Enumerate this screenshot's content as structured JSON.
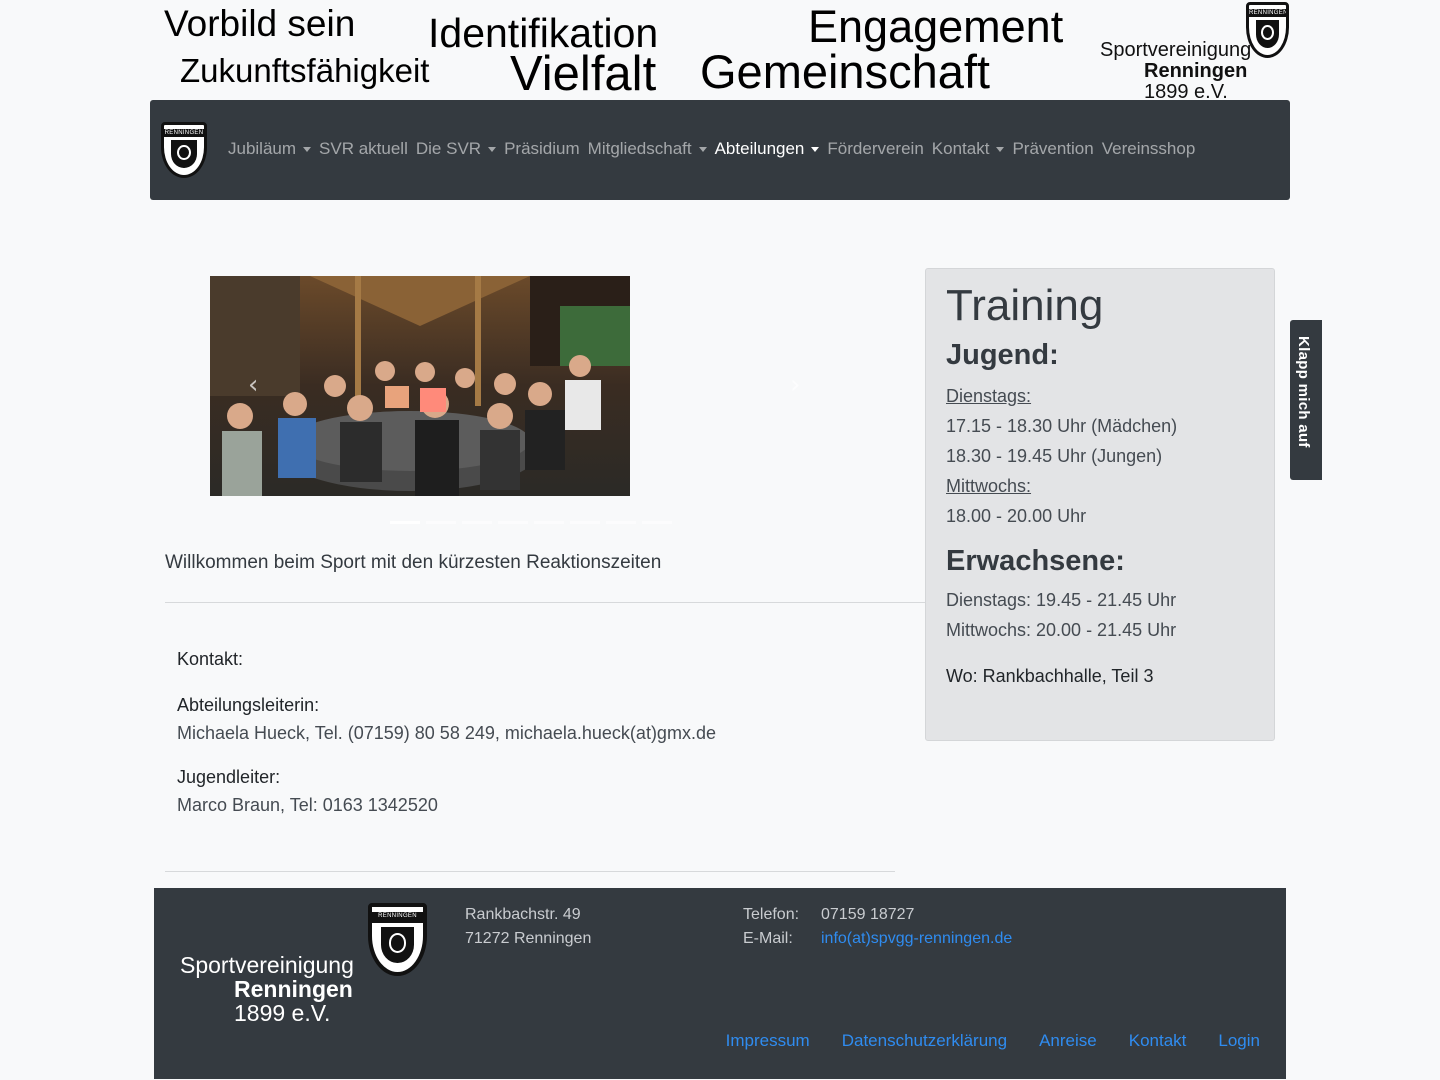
{
  "banner": {
    "slogans": [
      "Vorbild sein",
      "Zukunftsfähigkeit",
      "Identifikation",
      "Vielfalt",
      "Engagement",
      "Gemeinschaft"
    ],
    "logo": {
      "crest_text": "RENNINGEN",
      "line1": "Sportvereinigung",
      "line2": "Renningen",
      "line3": "1899 e.V."
    }
  },
  "nav": {
    "logo_icon": "club-crest-icon",
    "items": [
      {
        "label": "Jubiläum",
        "dropdown": true
      },
      {
        "label": "SVR aktuell",
        "dropdown": false
      },
      {
        "label": "Die SVR",
        "dropdown": true
      },
      {
        "label": "Präsidium",
        "dropdown": false
      },
      {
        "label": "Mitgliedschaft",
        "dropdown": true
      },
      {
        "label": "Abteilungen",
        "dropdown": true,
        "active": true
      },
      {
        "label": "Förderverein",
        "dropdown": false
      },
      {
        "label": "Kontakt",
        "dropdown": true
      },
      {
        "label": "Prävention",
        "dropdown": false
      },
      {
        "label": "Vereinsshop",
        "dropdown": false
      }
    ]
  },
  "carousel": {
    "prev_icon": "chevron-left-icon",
    "next_icon": "chevron-right-icon",
    "slide_count": 8,
    "active_index": 0
  },
  "main": {
    "welcome": "Willkommen beim Sport mit den kürzesten Reaktionszeiten",
    "contact_heading": "Kontakt:",
    "leader_label": "Abteilungsleiterin:",
    "leader_value": "Michaela Hueck, Tel. (07159) 80 58 249, michaela.hueck(at)gmx.de",
    "youth_label": "Jugendleiter:",
    "youth_value": "Marco Braun, Tel: 0163 1342520"
  },
  "training": {
    "title": "Training",
    "youth_heading": "Jugend:",
    "youth_day1": "Dienstags:",
    "youth_line1": "17.15 - 18.30 Uhr (Mädchen)",
    "youth_line2": "18.30 - 19.45 Uhr (Jungen)",
    "youth_day2": "Mittwochs:",
    "youth_line3": "18.00 - 20.00 Uhr",
    "adult_heading": "Erwachsene:",
    "adult_line1": "Dienstags: 19.45 - 21.45 Uhr",
    "adult_line2": "Mittwochs: 20.00 - 21.45 Uhr",
    "location": "Wo: Rankbachhalle, Teil 3"
  },
  "side_tab": {
    "label": "Klapp mich auf"
  },
  "footer": {
    "street": "Rankbachstr. 49",
    "city": "71272 Renningen",
    "phone_label": "Telefon:",
    "phone_value": "07159 18727",
    "email_label": "E-Mail:",
    "email_value": "info(at)spvgg-renningen.de",
    "links": [
      "Impressum",
      "Datenschutzerklärung",
      "Anreise",
      "Kontakt",
      "Login"
    ]
  },
  "colors": {
    "navbar_bg": "#343a40",
    "page_bg": "#f8f9fa",
    "card_bg": "#e3e4e6",
    "link": "#2f8cf0"
  }
}
